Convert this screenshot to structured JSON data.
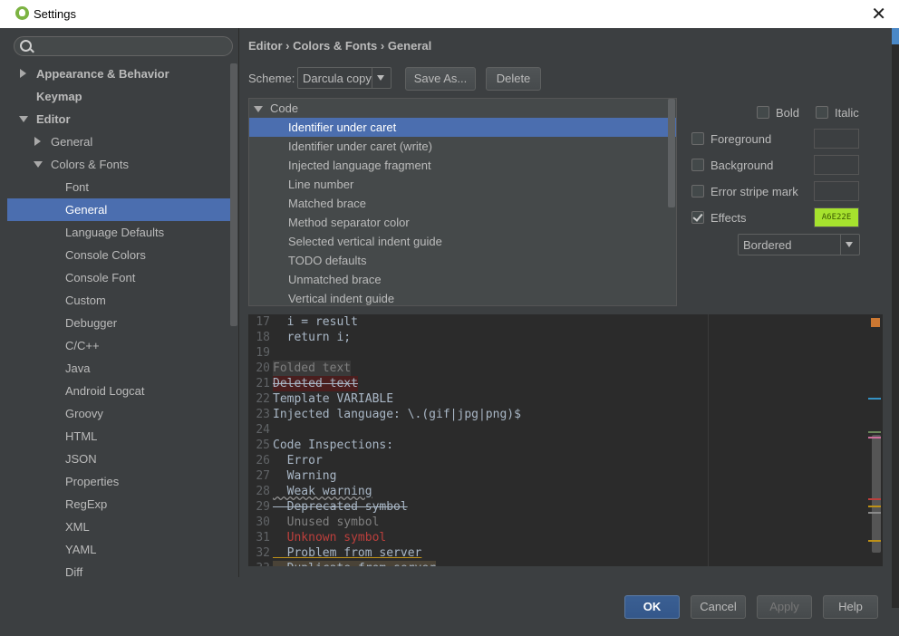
{
  "window": {
    "title": "Settings",
    "close_glyph": "✕"
  },
  "search": {
    "placeholder": ""
  },
  "tree": [
    {
      "label": "Appearance & Behavior",
      "expander": "right",
      "bold": true
    },
    {
      "label": "Keymap",
      "expander": null,
      "bold": true
    },
    {
      "label": "Editor",
      "expander": "down",
      "bold": true
    },
    {
      "label": "General",
      "expander": "right"
    },
    {
      "label": "Colors & Fonts",
      "expander": "down"
    },
    {
      "label": "Font"
    },
    {
      "label": "General",
      "selected": true
    },
    {
      "label": "Language Defaults"
    },
    {
      "label": "Console Colors"
    },
    {
      "label": "Console Font"
    },
    {
      "label": "Custom"
    },
    {
      "label": "Debugger"
    },
    {
      "label": "C/C++"
    },
    {
      "label": "Java"
    },
    {
      "label": "Android Logcat"
    },
    {
      "label": "Groovy"
    },
    {
      "label": "HTML"
    },
    {
      "label": "JSON"
    },
    {
      "label": "Properties"
    },
    {
      "label": "RegExp"
    },
    {
      "label": "XML"
    },
    {
      "label": "YAML"
    },
    {
      "label": "Diff"
    }
  ],
  "breadcrumb": "Editor › Colors & Fonts › General",
  "scheme": {
    "label": "Scheme:",
    "value": "Darcula copy",
    "save_as": "Save As...",
    "delete": "Delete"
  },
  "code_list": {
    "group": "Code",
    "items": [
      "Identifier under caret",
      "Identifier under caret (write)",
      "Injected language fragment",
      "Line number",
      "Matched brace",
      "Method separator color",
      "Selected vertical indent guide",
      "TODO defaults",
      "Unmatched brace",
      "Vertical indent guide"
    ],
    "selected_index": 0
  },
  "attributes": {
    "bold": "Bold",
    "italic": "Italic",
    "foreground": "Foreground",
    "background": "Background",
    "error_stripe": "Error stripe mark",
    "effects": "Effects",
    "effects_color": "A6E22E",
    "effects_type": "Bordered"
  },
  "preview": [
    {
      "n": "17",
      "text": "  i = result"
    },
    {
      "n": "18",
      "text": "  return i;"
    },
    {
      "n": "19",
      "text": ""
    },
    {
      "n": "20",
      "text": "Folded text"
    },
    {
      "n": "21",
      "text": "Deleted text"
    },
    {
      "n": "22",
      "text": "Template VARIABLE"
    },
    {
      "n": "23",
      "text": "Injected language: \\.(gif|jpg|png)$"
    },
    {
      "n": "24",
      "text": ""
    },
    {
      "n": "25",
      "text": "Code Inspections:"
    },
    {
      "n": "26",
      "text": "  Error"
    },
    {
      "n": "27",
      "text": "  Warning"
    },
    {
      "n": "28",
      "text": "  Weak warning"
    },
    {
      "n": "29",
      "text": "  Deprecated symbol"
    },
    {
      "n": "30",
      "text": "  Unused symbol"
    },
    {
      "n": "31",
      "text": "  Unknown symbol"
    },
    {
      "n": "32",
      "text": "  Problem from server"
    },
    {
      "n": "33",
      "text": "  Duplicate from server"
    }
  ],
  "buttons": {
    "ok": "OK",
    "cancel": "Cancel",
    "apply": "Apply",
    "help": "Help"
  },
  "colors": {
    "selection": "#4b6eaf",
    "background": "#3c3f41",
    "editor": "#2b2b2b",
    "effects_swatch": "#a6e22e"
  }
}
